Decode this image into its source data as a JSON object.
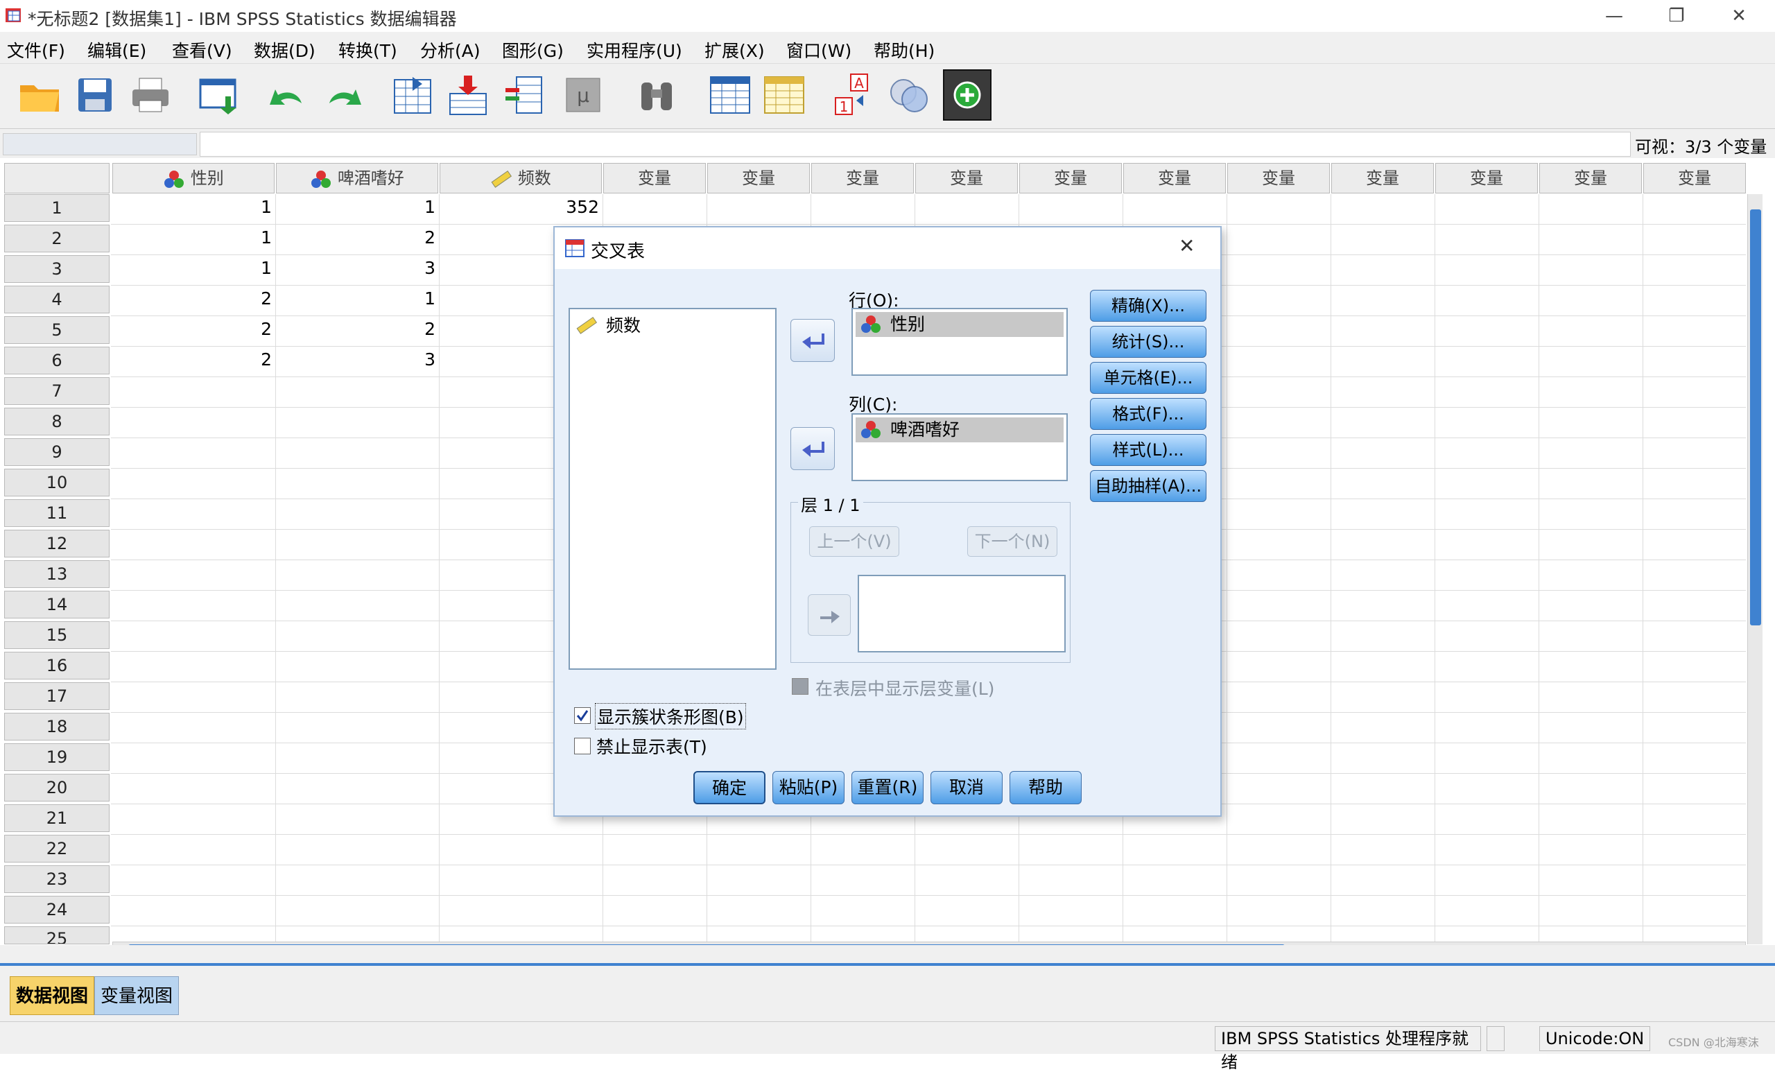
{
  "window": {
    "title": "*无标题2 [数据集1] - IBM SPSS Statistics 数据编辑器",
    "minimize": "—",
    "restore": "❐",
    "close": "✕"
  },
  "menu": [
    "文件(F)",
    "编辑(E)",
    "查看(V)",
    "数据(D)",
    "转换(T)",
    "分析(A)",
    "图形(G)",
    "实用程序(U)",
    "扩展(X)",
    "窗口(W)",
    "帮助(H)"
  ],
  "visible_vars": "可视：3/3 个变量",
  "columns": [
    "性别",
    "啤酒嗜好",
    "频数"
  ],
  "empty_col_label": "变量",
  "rows": [
    [
      "1",
      "1",
      "352"
    ],
    [
      "1",
      "2",
      ""
    ],
    [
      "1",
      "3",
      ""
    ],
    [
      "2",
      "1",
      ""
    ],
    [
      "2",
      "2",
      ""
    ],
    [
      "2",
      "3",
      ""
    ]
  ],
  "row_numbers": [
    "1",
    "2",
    "3",
    "4",
    "5",
    "6",
    "7",
    "8",
    "9",
    "10",
    "11",
    "12",
    "13",
    "14",
    "15",
    "16",
    "17",
    "18",
    "19",
    "20",
    "21",
    "22",
    "23",
    "24",
    "25"
  ],
  "tabs": {
    "data_view": "数据视图",
    "var_view": "变量视图"
  },
  "status": {
    "processor": "IBM SPSS Statistics 处理程序就绪",
    "unicode": "Unicode:ON",
    "watermark": "CSDN @北海寒沫"
  },
  "dialog": {
    "title": "交叉表",
    "close": "✕",
    "source_list": [
      "频数"
    ],
    "rows_label": "行(O):",
    "rows_items": [
      "性别"
    ],
    "cols_label": "列(C):",
    "cols_items": [
      "啤酒嗜好"
    ],
    "layer_label": "层 1 / 1",
    "prev_btn": "上一个(V)",
    "next_btn": "下一个(N)",
    "side_buttons": [
      "精确(X)...",
      "统计(S)...",
      "单元格(E)...",
      "格式(F)...",
      "样式(L)...",
      "自助抽样(A)..."
    ],
    "layer_check": "在表层中显示层变量(L)",
    "check_bar": "显示簇状条形图(B)",
    "check_bar_checked": true,
    "check_suppress": "禁止显示表(T)",
    "check_suppress_checked": false,
    "buttons": [
      "确定",
      "粘贴(P)",
      "重置(R)",
      "取消",
      "帮助"
    ]
  },
  "colors": {
    "accent": "#4e9de6",
    "dialog_bg": "#e8f0fa",
    "scroll": "#3f82d0"
  }
}
